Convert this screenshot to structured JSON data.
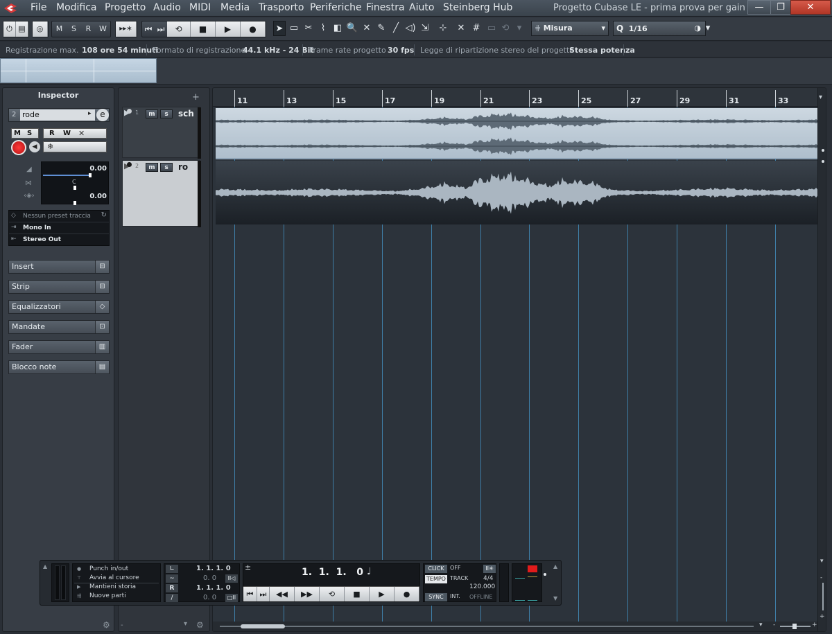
{
  "window": {
    "title": "Progetto Cubase LE - prima prova per gain"
  },
  "menu": [
    "File",
    "Modifica",
    "Progetto",
    "Audio",
    "MIDI",
    "Media",
    "Trasporto",
    "Periferiche",
    "Finestra",
    "Aiuto",
    "Steinberg Hub"
  ],
  "window_buttons": {
    "minimize": "—",
    "maximize": "❐",
    "close": "✕"
  },
  "toolbar": {
    "msrw": [
      "M",
      "S",
      "R",
      "W"
    ],
    "transport_buttons": [
      "⏮",
      "⏭",
      "⟲",
      "■",
      "▶",
      "●"
    ],
    "grid_label": "Misura",
    "quantize_prefix": "Q",
    "quantize_value": "1/16",
    "tools": [
      "select-arrow-icon",
      "range-icon",
      "split-icon",
      "glue-icon",
      "erase-icon",
      "zoom-icon",
      "mute-icon",
      "draw-icon",
      "line-icon",
      "play-icon",
      "mute-icon2"
    ]
  },
  "status": [
    {
      "label": "Registrazione max.",
      "value": "108 ore 54 minuti"
    },
    {
      "label": "Formato di registrazione",
      "value": "44.1 kHz - 24 Bit"
    },
    {
      "label": "Frame rate progetto",
      "value": "30 fps"
    },
    {
      "label": "Legge di ripartizione stereo del progetto",
      "value": "Stessa potenza"
    }
  ],
  "inspector": {
    "title": "Inspector",
    "track_number": "2",
    "track_name": "rode",
    "volume": "0.00",
    "pan": "C",
    "pan_value": "0.00",
    "preset": "Nessun preset traccia",
    "input": "Mono In",
    "output": "Stereo Out",
    "mstrw": [
      "M",
      "S",
      "R",
      "W"
    ],
    "sections": [
      "Insert",
      "Strip",
      "Equalizzatori",
      "Mandate",
      "Fader",
      "Blocco note"
    ]
  },
  "tracks": [
    {
      "number": "1",
      "name": "sch",
      "record_armed": false
    },
    {
      "number": "2",
      "name": "ro",
      "record_armed": true
    }
  ],
  "tracklist": {
    "add_button": "+"
  },
  "ruler": {
    "labels": [
      "11",
      "13",
      "15",
      "17",
      "19",
      "21",
      "23",
      "25",
      "27",
      "29",
      "31",
      "33"
    ]
  },
  "transport": {
    "options": [
      "Punch in/out",
      "Avvia al cursore",
      "Mantieni storia",
      "Nuove parti"
    ],
    "left_locator": "1. 1. 1.   0",
    "left_offset": "0.   0",
    "right_locator": "1. 1. 1.   0",
    "right_offset": "0.   0",
    "position": "1.  1.  1.   0",
    "click": "CLICK",
    "click_state": "OFF",
    "tempo": "TEMPO",
    "tempo_mode": "TRACK",
    "signature": "4/4",
    "bpm": "120.000",
    "sync": "SYNC",
    "sync_mode": "INT.",
    "sync_state": "OFFLINE",
    "L": "L",
    "R": "R"
  },
  "colors": {
    "accent_blue": "#3f7fa8",
    "record_red": "#d0262a",
    "event_light": "#b8c7d3",
    "event_dark": "#1f252c"
  }
}
